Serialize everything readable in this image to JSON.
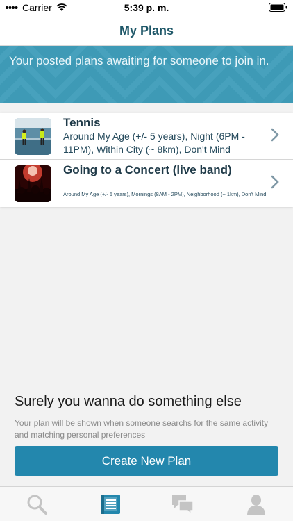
{
  "status_bar": {
    "carrier": "Carrier",
    "time": "5:39 p. m."
  },
  "nav": {
    "title": "My Plans"
  },
  "banner": {
    "text": "Your posted plans awaiting for someone to join in."
  },
  "plans": [
    {
      "title": "Tennis",
      "description": "Around My Age (+/- 5 years), Night (6PM - 11PM), Within City (~ 8km), Don't Mind",
      "thumb": "tennis-photo"
    },
    {
      "title": "Going to a Concert (live band)",
      "description": "Around My Age (+/- 5 years), Mornings (8AM - 2PM), Neighborhood (~ 1km), Don't Mind",
      "thumb": "concert-photo"
    }
  ],
  "empty_state": {
    "title": "Surely you wanna do something else",
    "subtitle": "Your plan will be shown when someone searchs for the same activity and matching personal preferences"
  },
  "create_button": {
    "label": "Create New Plan"
  },
  "tabs": [
    {
      "icon": "search-icon",
      "active": false
    },
    {
      "icon": "plans-list-icon",
      "active": true
    },
    {
      "icon": "chat-icon",
      "active": false
    },
    {
      "icon": "profile-icon",
      "active": false
    }
  ],
  "colors": {
    "accent": "#2387ad",
    "banner": "#3e9ab6",
    "title": "#1e5768",
    "inactive_tab": "#c4c4c4"
  }
}
